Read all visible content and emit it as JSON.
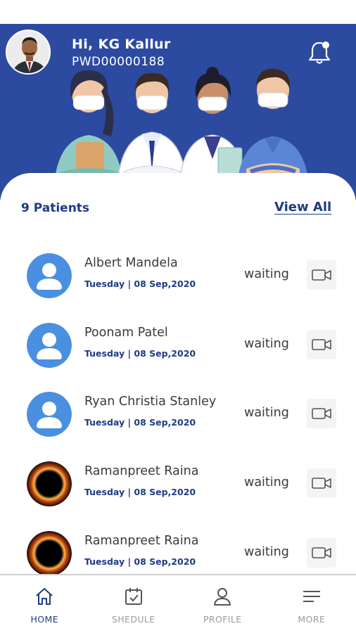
{
  "header": {
    "greeting": "Hi, KG  Kallur",
    "patient_id": "PWD00000188",
    "bell_icon": "notification-bell-icon",
    "background_color": "#2c4a9f"
  },
  "patients": {
    "count_label": "9 Patients",
    "view_all_label": "View All",
    "list": [
      {
        "name": "Albert Mandela",
        "date": "Tuesday | 08 Sep,2020",
        "status": "waiting",
        "avatar": "default-user-icon"
      },
      {
        "name": "Poonam Patel",
        "date": "Tuesday | 08 Sep,2020",
        "status": "waiting",
        "avatar": "default-user-icon"
      },
      {
        "name": "Ryan Christia Stanley",
        "date": "Tuesday | 08 Sep,2020",
        "status": "waiting",
        "avatar": "default-user-icon"
      },
      {
        "name": "Ramanpreet Raina",
        "date": "Tuesday | 08 Sep,2020",
        "status": "waiting",
        "avatar": "eclipse-photo"
      },
      {
        "name": "Ramanpreet Raina",
        "date": "Tuesday | 08 Sep,2020",
        "status": "waiting",
        "avatar": "eclipse-photo"
      }
    ]
  },
  "nav": {
    "items": [
      {
        "label": "HOME",
        "icon": "home-icon",
        "active": true
      },
      {
        "label": "SHEDULE",
        "icon": "calendar-icon",
        "active": false
      },
      {
        "label": "PROFILE",
        "icon": "profile-icon",
        "active": false
      },
      {
        "label": "MORE",
        "icon": "menu-icon",
        "active": false
      }
    ]
  },
  "colors": {
    "primary": "#2c4a9f",
    "accent_text": "#1f3b84",
    "avatar_blue": "#4a8fe0"
  }
}
